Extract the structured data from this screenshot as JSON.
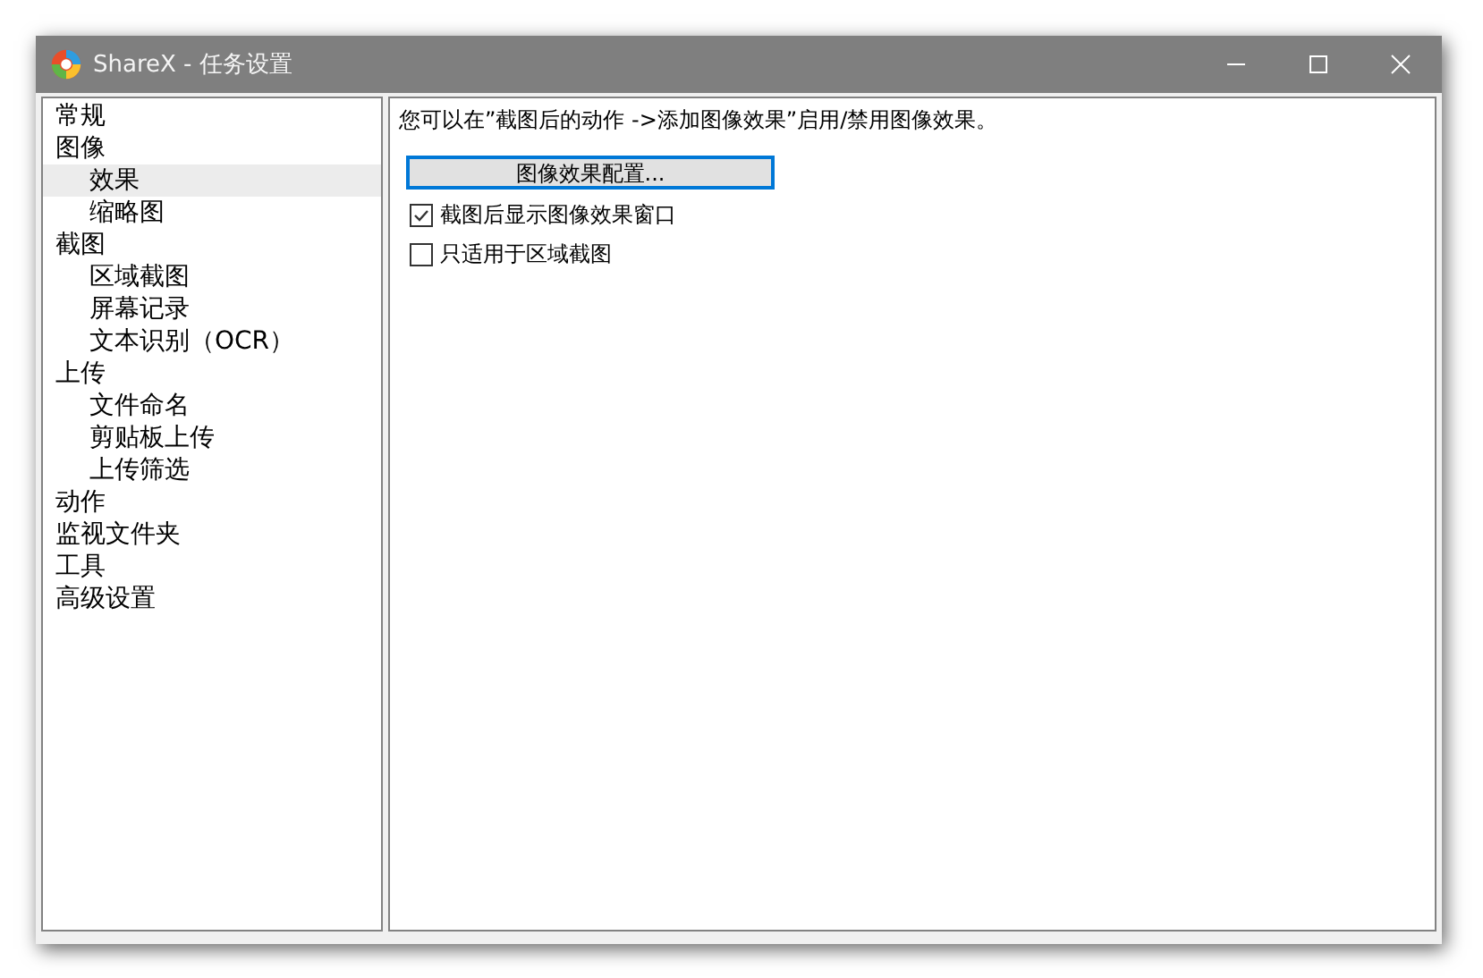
{
  "window": {
    "title": "ShareX - 任务设置"
  },
  "sidebar": {
    "items": [
      {
        "label": "常规",
        "selected": false
      },
      {
        "label": "图像",
        "selected": false,
        "children": [
          {
            "label": "效果",
            "selected": true
          },
          {
            "label": "缩略图",
            "selected": false
          }
        ]
      },
      {
        "label": "截图",
        "selected": false,
        "children": [
          {
            "label": "区域截图",
            "selected": false
          },
          {
            "label": "屏幕记录",
            "selected": false
          },
          {
            "label": "文本识别（OCR）",
            "selected": false
          }
        ]
      },
      {
        "label": "上传",
        "selected": false,
        "children": [
          {
            "label": "文件命名",
            "selected": false
          },
          {
            "label": "剪贴板上传",
            "selected": false
          },
          {
            "label": "上传筛选",
            "selected": false
          }
        ]
      },
      {
        "label": "动作",
        "selected": false
      },
      {
        "label": "监视文件夹",
        "selected": false
      },
      {
        "label": "工具",
        "selected": false
      },
      {
        "label": "高级设置",
        "selected": false
      }
    ]
  },
  "content": {
    "description": "您可以在”截图后的动作 ->添加图像效果”启用/禁用图像效果。",
    "button": "图像效果配置...",
    "checkboxes": [
      {
        "label": "截图后显示图像效果窗口",
        "checked": true
      },
      {
        "label": "只适用于区域截图",
        "checked": false
      }
    ]
  }
}
